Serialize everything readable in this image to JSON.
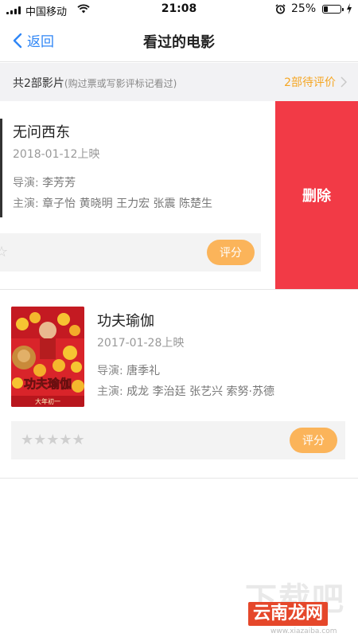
{
  "status": {
    "carrier": "中国移动",
    "time": "21:08",
    "battery": "25%",
    "battery_level": 0.25
  },
  "nav": {
    "back_label": "返回",
    "title": "看过的电影"
  },
  "summary": {
    "count_text": "共2部影片",
    "sub_text": "(购过票或写影评标记看过)",
    "pending_text": "2部待评价"
  },
  "movies": [
    {
      "title": "无问西东",
      "date": "2018-01-12上映",
      "director_label": "导演:",
      "director": "李芳芳",
      "cast_label": "主演:",
      "cast": "章子怡 黄晓明 王力宏 张震 陈楚生",
      "rate_label": "评分",
      "delete_label": "删除",
      "stars": "☆"
    },
    {
      "title": "功夫瑜伽",
      "date": "2017-01-28上映",
      "director_label": "导演:",
      "director": "唐季礼",
      "cast_label": "主演:",
      "cast": "成龙 李治廷 张艺兴 索努·苏德",
      "rate_label": "评分",
      "stars": "★★★★★",
      "poster_title": "功夫瑜伽",
      "poster_sub": "大年初一"
    }
  ],
  "watermark": {
    "big": "下载吧",
    "main": "云南龙网",
    "url": "www.xiazaiba.com"
  },
  "colors": {
    "accent_blue": "#2f86f6",
    "orange": "#f5a623",
    "rate_button": "#fbb45a",
    "delete_red": "#f23a46",
    "summary_bg": "#f2f2f4"
  }
}
